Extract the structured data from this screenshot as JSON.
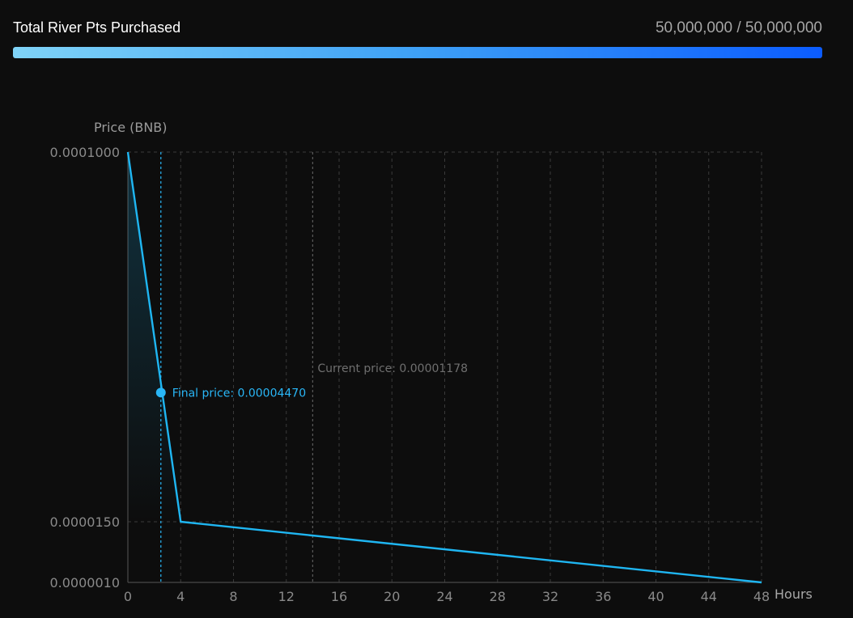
{
  "header": {
    "title": "Total River Pts Purchased",
    "count": "50,000,000 / 50,000,000",
    "progress": 1.0
  },
  "chart_data": {
    "type": "line",
    "ylabel": "Price (BNB)",
    "xlabel": "Hours",
    "xlim": [
      0,
      48
    ],
    "x_ticks": [
      0,
      4,
      8,
      12,
      16,
      20,
      24,
      28,
      32,
      36,
      40,
      44,
      48
    ],
    "x_tick_labels": [
      "0",
      "4",
      "8",
      "12",
      "16",
      "20",
      "24",
      "28",
      "32",
      "36",
      "40",
      "44",
      "48"
    ],
    "y_ticks": [
      1e-06,
      1.5e-05,
      0.0001
    ],
    "y_tick_labels": [
      "0.0000010",
      "0.0000150",
      "0.0001000"
    ],
    "grid": true,
    "series": [
      {
        "x": [
          0,
          4,
          48
        ],
        "y": [
          0.0001,
          1.5e-05,
          1e-06
        ],
        "color": "#1fb6f2"
      }
    ],
    "annotations": [
      {
        "label": "Final price: 0.00004470",
        "x": 2.5,
        "y": 4.47e-05,
        "color": "#29b6f6"
      },
      {
        "label": "Current price: 0.00001178",
        "x": 14,
        "color": "#6f6f6f"
      }
    ]
  }
}
